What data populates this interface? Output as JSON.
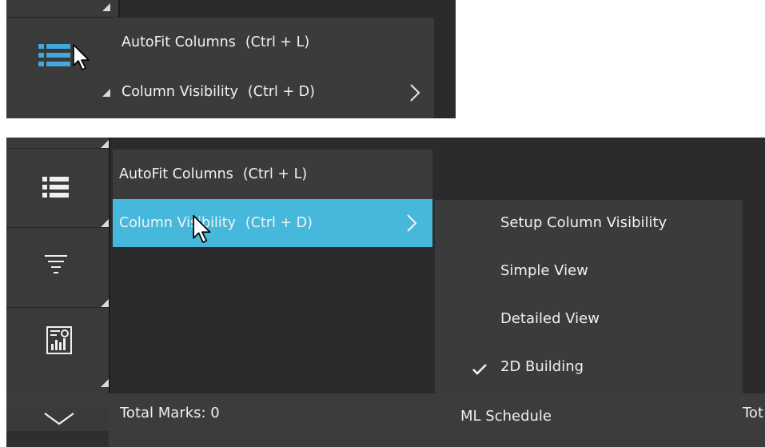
{
  "top_panel": {
    "menu": {
      "items": [
        {
          "label": "AutoFit Columns",
          "shortcut": "(Ctrl + L)"
        },
        {
          "label": "Column Visibility",
          "shortcut": "(Ctrl + D)",
          "submenu_indicator": "chevron-right-icon"
        }
      ]
    },
    "rail_icons": [
      "list-icon"
    ]
  },
  "bottom_panel": {
    "menu": {
      "items": [
        {
          "label": "AutoFit Columns",
          "shortcut": "(Ctrl + L)"
        },
        {
          "label": "Column Visibility",
          "shortcut": "(Ctrl + D)",
          "highlighted": true,
          "submenu_indicator": "chevron-right-icon"
        }
      ]
    },
    "submenu": {
      "items": [
        {
          "label": "Setup Column Visibility",
          "checked": false
        },
        {
          "label": "Simple View",
          "checked": false
        },
        {
          "label": "Detailed View",
          "checked": false
        },
        {
          "label": "2D Building",
          "checked": true
        }
      ]
    },
    "rail_icons": [
      "list-icon",
      "filter-icon",
      "report-icon",
      "chevron-down-icon"
    ],
    "status": {
      "total_marks": "Total Marks: 0",
      "schedule": "ML Schedule",
      "truncated": "Tot"
    }
  },
  "colors": {
    "highlight": "#45b8dc",
    "icon_active": "#3fa9e0",
    "panel_bg": "#2b2b2b",
    "menu_bg": "#3b3b3b"
  }
}
